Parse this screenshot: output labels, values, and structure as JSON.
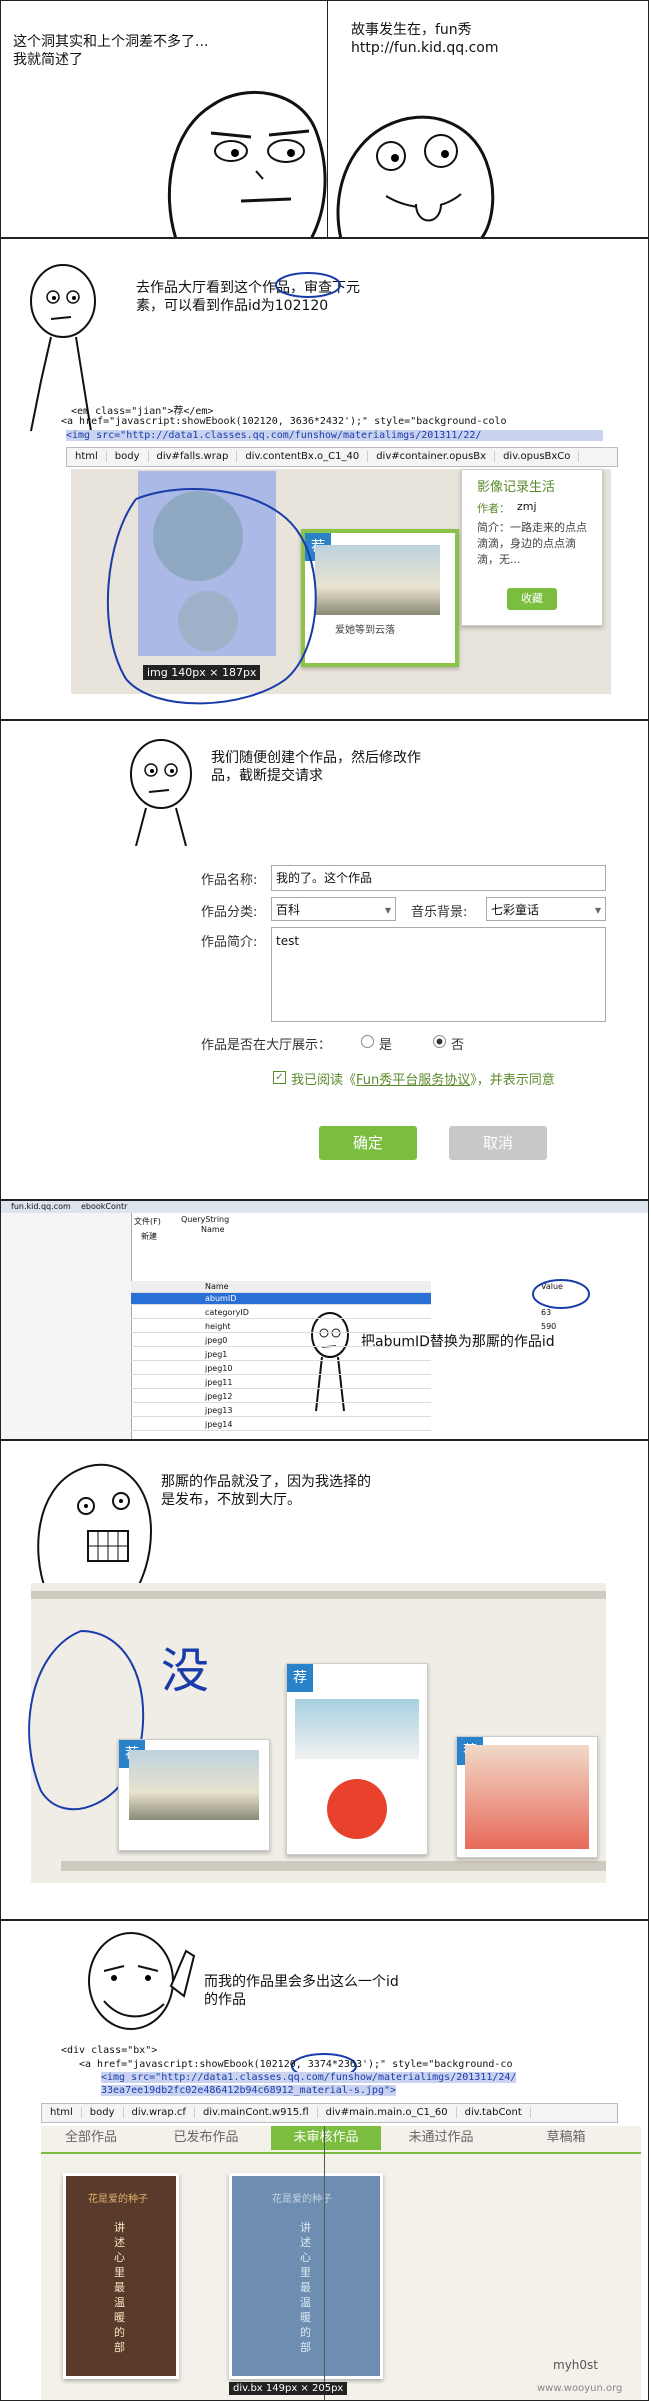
{
  "panel1": {
    "left_text": "这个洞其实和上个洞差不多了...\n我就简述了",
    "right_text": "故事发生在，fun秀\nhttp://fun.kid.qq.com"
  },
  "panel2": {
    "caption": "去作品大厅看到这个作品，审查下元\n素，可以看到作品id为102120",
    "code_line1": "<em class=\"jian\">荐</em>",
    "code_line2": "<a href=\"javascript:showEbook(102120, 3636*2432');\" style=\"background-colo",
    "code_line3": "<img src=\"http://data1.classes.qq.com/funshow/materialimgs/201311/22/",
    "breadcrumbs": [
      "html",
      "body",
      "div#falls.wrap",
      "div.contentBx.o_C1_40",
      "div#container.opusBx",
      "div.opusBxCo"
    ],
    "size_label": "img 140px × 187px",
    "tag": "荐",
    "photo_caption": "爱她等到云落",
    "popup": {
      "title": "影像记录生活",
      "author_label": "作者：",
      "author": "zmj",
      "intro": "简介：一路走来的点点\n滴滴，身边的点点滴\n滴，无...",
      "collect": "收藏"
    }
  },
  "panel3": {
    "caption": "我们随便创建个作品，然后修改作\n品，截断提交请求",
    "form": {
      "name_label": "作品名称:",
      "name_value": "我的了。这个作品",
      "category_label": "作品分类:",
      "category_value": "百科",
      "music_label": "音乐背景:",
      "music_value": "七彩童话",
      "intro_label": "作品简介:",
      "intro_value": "test",
      "show_label": "作品是否在大厅展示：",
      "yes": "是",
      "no": "否",
      "agree_prefix": "我已阅读《",
      "agree_link": "Fun秀平台服务协议",
      "agree_suffix": "》，并表示同意",
      "ok": "确定",
      "cancel": "取消"
    }
  },
  "panel4": {
    "caption": "把abumID替换为那厮的作品id",
    "tabs": [
      "fun.kid.qq.com",
      "ebookContr"
    ],
    "menu": [
      "文件(F)",
      "新建"
    ],
    "querystring": "QueryString",
    "name_header": "Name",
    "value_header": "Value",
    "rows": [
      {
        "name": "abumID",
        "value": "108197"
      },
      {
        "name": "categoryID",
        "value": "63"
      },
      {
        "name": "height",
        "value": "590"
      },
      {
        "name": "jpeg0",
        "value": ""
      },
      {
        "name": "jpeg1",
        "value": ""
      },
      {
        "name": "jpeg10",
        "value": ""
      },
      {
        "name": "jpeg11",
        "value": ""
      },
      {
        "name": "jpeg12",
        "value": ""
      },
      {
        "name": "jpeg13",
        "value": ""
      },
      {
        "name": "jpeg14",
        "value": ""
      }
    ]
  },
  "panel5": {
    "caption": "那厮的作品就没了，因为我选择的\n是发布，不放到大厅。",
    "scribble": "没",
    "tag": "荐"
  },
  "panel6": {
    "caption": "而我的作品里会多出这么一个id\n的作品",
    "code_line1": "<div class=\"bx\">",
    "code_line2": "<a href=\"javascript:showEbook(102120, 3374*2363');\" style=\"background-co",
    "code_line3": "<img src=\"http://data1.classes.qq.com/funshow/materialimgs/201311/24/",
    "code_line4": "33ea7ee19db2fc02e486412b94c68912_material-s.jpg\">",
    "breadcrumbs": [
      "html",
      "body",
      "div.wrap.cf",
      "div.mainCont.w915.fl",
      "div#main.main.o_C1_60",
      "div.tabCont"
    ],
    "tabs": [
      "全部作品",
      "已发布作品",
      "未审核作品",
      "未通过作品",
      "草稿箱"
    ],
    "book_title": "花是爱的种子",
    "book_text": "讲\n述\n心\n里\n最\n温\n暖\n的\n部",
    "size_label": "div.bx 149px × 205px",
    "watermark_1": "myh0st",
    "watermark_2": "www.wooyun.org"
  },
  "colors": {
    "green": "#7bbd3e",
    "blue_tag": "#2a82c8",
    "ink": "#1a3caa",
    "highlight": "#aab9e6"
  }
}
